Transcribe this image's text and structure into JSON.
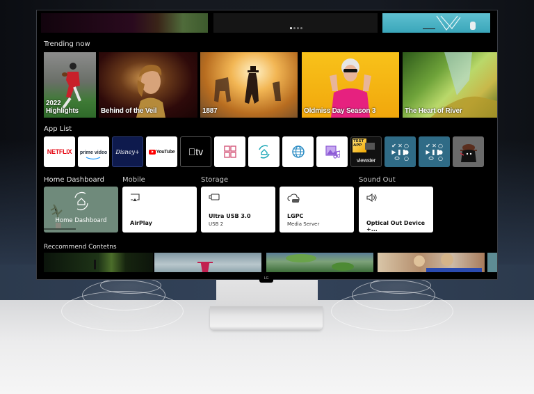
{
  "device": {
    "brand_badge": "LG"
  },
  "banner": {
    "slides_total": 4,
    "active_slide": 1
  },
  "trending": {
    "title": "Trending now",
    "items": [
      {
        "label_line1": "2022",
        "label_line2": "Highlights"
      },
      {
        "label_line1": "",
        "label_line2": "Behind of the Veil"
      },
      {
        "label_line1": "",
        "label_line2": "1887"
      },
      {
        "label_line1": "",
        "label_line2": "Oldmiss Day Season 3"
      },
      {
        "label_line1": "",
        "label_line2": "The Heart of River"
      }
    ]
  },
  "app_list": {
    "title": "App List",
    "apps": [
      {
        "name": "NETFLIX",
        "icon": "netflix-logo"
      },
      {
        "name": "prime video",
        "icon": "prime-video-logo"
      },
      {
        "name": "Disney+",
        "icon": "disney-plus-logo"
      },
      {
        "name": "YouTube",
        "icon": "youtube-logo"
      },
      {
        "name": "tv",
        "icon": "apple-tv-logo"
      },
      {
        "name": "Apps",
        "icon": "grid-icon"
      },
      {
        "name": "Home Hub",
        "icon": "home-circle-icon"
      },
      {
        "name": "Web Browser",
        "icon": "globe-icon"
      },
      {
        "name": "Media Player",
        "icon": "photo-music-icon"
      },
      {
        "name": "viewster",
        "badge": "TEST APP",
        "icon": "viewster-logo"
      },
      {
        "name": "Game Controller 1",
        "icon": "controller-icon"
      },
      {
        "name": "Game Controller 2",
        "icon": "controller-icon"
      },
      {
        "name": "Spy Game",
        "icon": "spy-character-icon"
      }
    ],
    "colors": {
      "disney_bg": "#0e1a4d",
      "controller_bg": "#2f6b86",
      "grid_icon": "#d4577b",
      "home_icon": "#1fa9b8",
      "globe_icon": "#2b8cc4",
      "media_icon": "#8d5ad6"
    }
  },
  "dashboard": {
    "sections": {
      "home": "Home Dashboard",
      "mobile": "Mobile",
      "storage": "Storage",
      "sound": "Sound Out"
    },
    "cards": {
      "home": {
        "label": "Home Dashboard"
      },
      "airplay": {
        "title": "AirPlay"
      },
      "usb": {
        "title": "Ultra USB 3.0",
        "subtitle": "USB 2"
      },
      "lgpc": {
        "title": "LGPC",
        "subtitle": "Media Server"
      },
      "optical": {
        "title": "Optical Out Device +..."
      }
    },
    "colors": {
      "home_card_bg": "#6f8a7b"
    }
  },
  "recommend": {
    "title": "Reccommend Contetns",
    "items_visible": 5
  }
}
